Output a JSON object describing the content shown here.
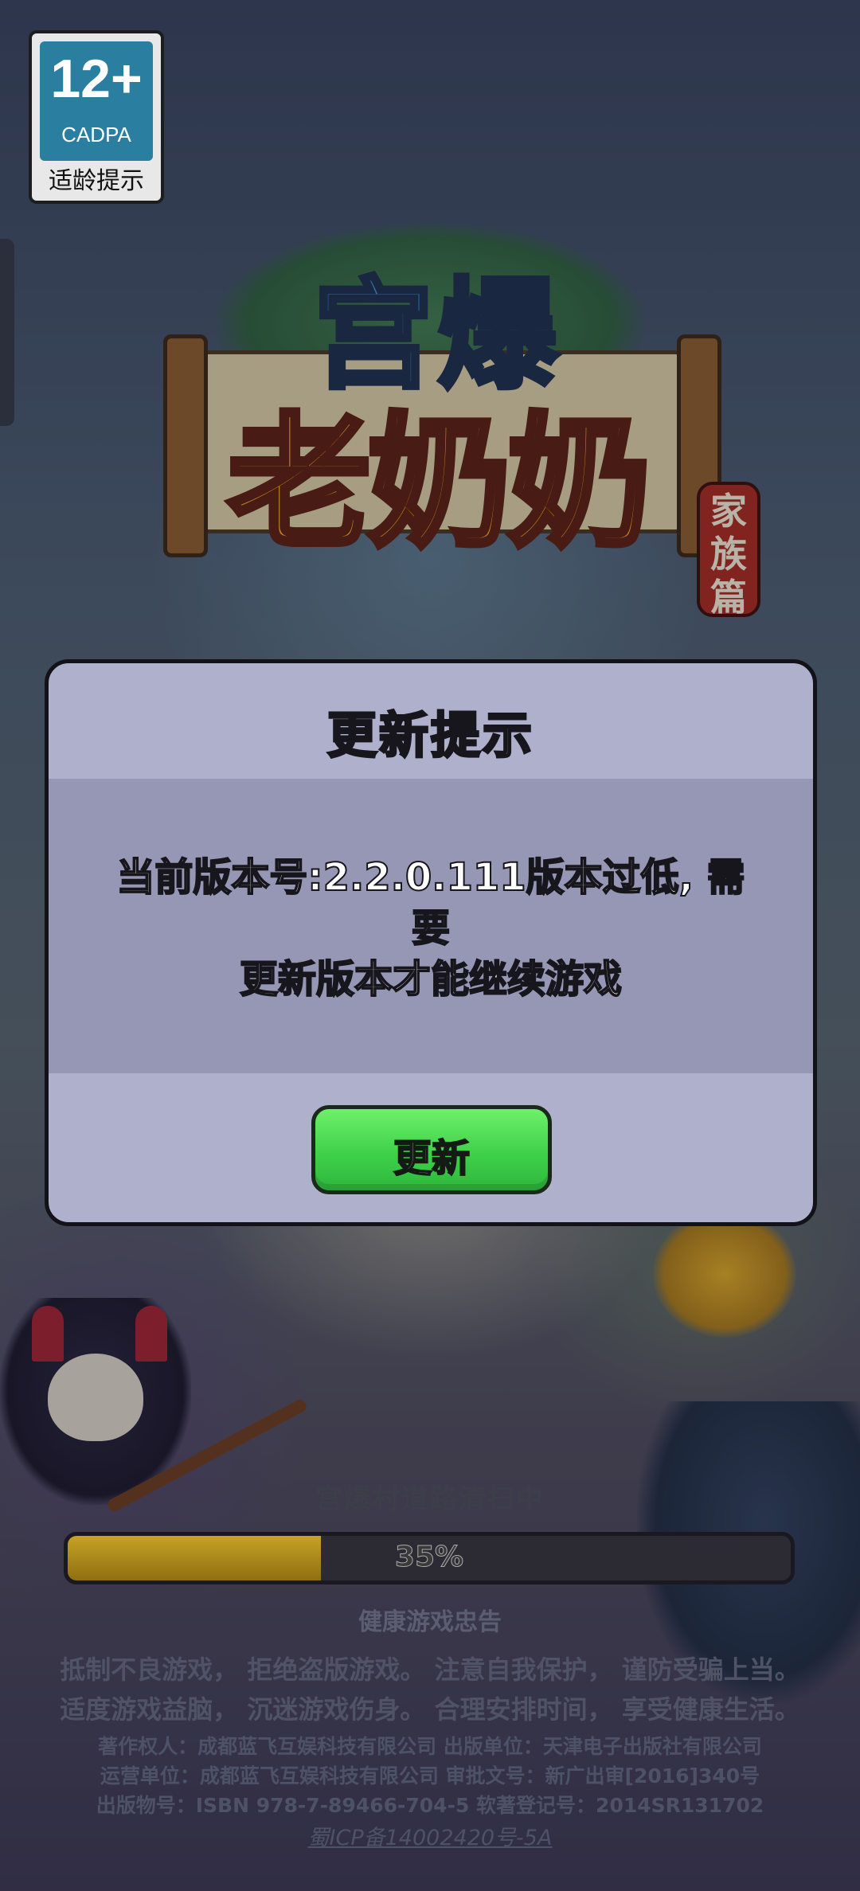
{
  "age_rating": {
    "number": "12+",
    "org": "CADPA",
    "tip": "适龄提示"
  },
  "logo": {
    "top": "宫爆",
    "main": "老奶奶",
    "seal": "家族篇"
  },
  "modal": {
    "title": "更新提示",
    "message_line1": "当前版本号:2.2.0.111版本过低, 需要",
    "message_line2": "更新版本才能继续游戏",
    "button_label": "更新"
  },
  "loading": {
    "text": "宫爆村道路清扫中",
    "progress": 0.35,
    "progress_label": "35%"
  },
  "health_notice": {
    "title": "健康游戏忠告",
    "line1": "抵制不良游戏， 拒绝盗版游戏。 注意自我保护， 谨防受骗上当。",
    "line2": "适度游戏益脑， 沉迷游戏伤身。 合理安排时间， 享受健康生活。"
  },
  "legal": {
    "line1": "著作权人：成都蓝飞互娱科技有限公司  出版单位：天津电子出版社有限公司",
    "line2": "运营单位：成都蓝飞互娱科技有限公司  审批文号：新广出审[2016]340号",
    "line3": "出版物号：ISBN 978-7-89466-704-5  软著登记号：2014SR131702",
    "icp": "蜀ICP备14002420号-5A"
  }
}
